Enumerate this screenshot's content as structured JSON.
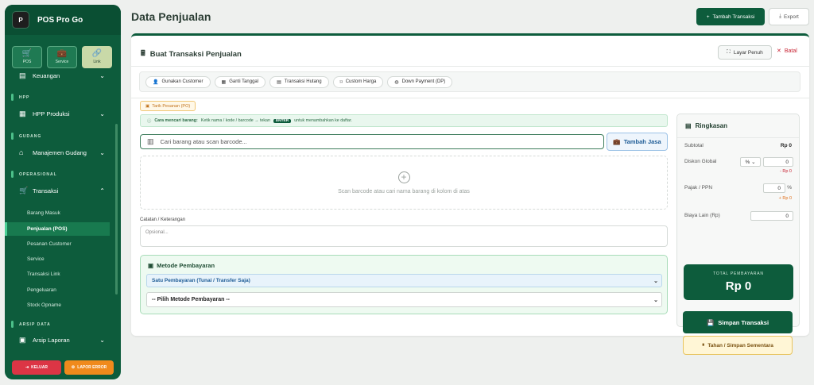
{
  "app": {
    "name": "POS Pro Go",
    "logo_text": "P"
  },
  "modes": [
    {
      "label": "POS",
      "icon": "cart-icon"
    },
    {
      "label": "Service",
      "icon": "briefcase-icon"
    },
    {
      "label": "Link",
      "icon": "link-icon"
    }
  ],
  "sidebar": {
    "keuangan": "Keuangan",
    "sec_hpp": "HPP",
    "hpp_produksi": "HPP Produksi",
    "sec_gudang": "GUDANG",
    "manajemen_gudang": "Manajemen Gudang",
    "sec_operasional": "OPERASIONAL",
    "transaksi": "Transaksi",
    "sub_items": [
      "Barang Masuk",
      "Penjualan (POS)",
      "Pesanan Customer",
      "Service",
      "Transaksi Link",
      "Pengeluaran",
      "Stock Opname"
    ],
    "sec_arsip": "ARSIP DATA",
    "arsip_laporan": "Arsip Laporan",
    "logout": "KELUAR",
    "report_error": "LAPOR ERROR"
  },
  "header": {
    "title": "Data Penjualan",
    "add_label": "Tambah Transaksi",
    "export_label": "Export"
  },
  "card": {
    "title": "Buat Transaksi Penjualan",
    "fullscreen": "Layar Penuh",
    "cancel": "Batal",
    "options": [
      "Gunakan Customer",
      "Ganti Tanggal",
      "Transaksi Hutang",
      "Custom Harga",
      "Down Payment (DP)"
    ],
    "po_button": "Tarik Pesanan (PO)",
    "tip_bold": "Cara mencari barang:",
    "tip_text": "Ketik nama / kode / barcode → tekan",
    "tip_key": "ENTER",
    "tip_after": "untuk menambahkan ke daftar.",
    "search_placeholder": "Cari barang atau scan barcode...",
    "jasa_button": "Tambah Jasa",
    "empty_text": "Scan barcode atau cari nama barang di kolom di atas",
    "notes_label": "Catatan / Keterangan",
    "notes_placeholder": "Opsional...",
    "payment_title": "Metode Pembayaran",
    "payment_type": "Satu Pembayaran (Tunai / Transfer Saja)",
    "payment_method": "-- Pilih Metode Pembayaran --"
  },
  "summary": {
    "title": "Ringkasan",
    "subtotal_label": "Subtotal",
    "subtotal_value": "Rp 0",
    "discount_label": "Diskon Global",
    "discount_type": "%",
    "discount_value": "0",
    "discount_amount": "- Rp 0",
    "tax_label": "Pajak / PPN",
    "tax_value": "0",
    "tax_unit": "%",
    "tax_amount": "+ Rp 0",
    "other_label": "Biaya Lain (Rp)",
    "other_value": "0",
    "total_label": "TOTAL PEMBAYARAN",
    "total_value": "Rp 0",
    "save": "Simpan Transaksi",
    "hold": "Tahan / Simpan Sementara"
  }
}
